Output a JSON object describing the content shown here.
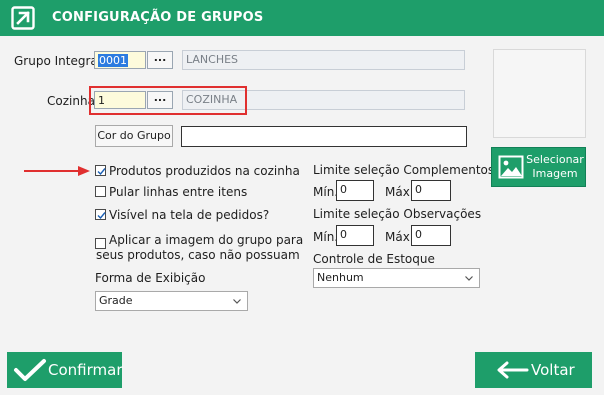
{
  "window": {
    "title": "CONFIGURAÇÃO DE GRUPOS"
  },
  "grupo_integra": {
    "label": "Grupo Integra:",
    "code": "0001",
    "lookup": "...",
    "name": "LANCHES"
  },
  "cozinha": {
    "label": "Cozinha:",
    "code": "1",
    "lookup": "...",
    "name": "COZINHA"
  },
  "cor": {
    "button": "Cor do Grupo",
    "value": ""
  },
  "options": {
    "produtos_cozinha": "Produtos produzidos na cozinha",
    "pular_linhas": "Pular linhas entre itens",
    "visivel_pedidos": "Visível na tela de pedidos?",
    "aplicar_imagem_1": "Aplicar a imagem do grupo para",
    "aplicar_imagem_2": "seus produtos, caso não possuam"
  },
  "checked": {
    "produtos_cozinha": true,
    "pular_linhas": false,
    "visivel_pedidos": true,
    "aplicar_imagem": false
  },
  "forma_exibicao": {
    "label": "Forma de Exibição",
    "value": "Grade"
  },
  "complementos": {
    "label": "Limite seleção Complementos",
    "min_label": "Mín.",
    "min": "0",
    "max_label": "Máx.",
    "max": "0"
  },
  "observacoes": {
    "label": "Limite seleção Observações",
    "min_label": "Mín.",
    "min": "0",
    "max_label": "Máx.",
    "max": "0"
  },
  "estoque": {
    "label": "Controle de Estoque",
    "value": "Nenhum"
  },
  "imagem": {
    "button_line1": "Selecionar",
    "button_line2": "Imagem"
  },
  "footer": {
    "confirm": "Confirmar",
    "back": "Voltar"
  },
  "colors": {
    "brand_green": "#1e9e6a",
    "highlight_red": "#e02f2f",
    "selection_blue": "#2b7be0"
  }
}
